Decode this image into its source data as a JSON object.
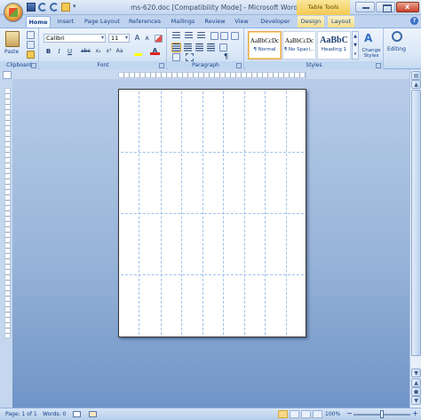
{
  "window": {
    "title": "ms-620.doc [Compatibility Mode] - Microsoft Word",
    "contextual_tab_group": "Table Tools"
  },
  "tabs": [
    {
      "label": "Home",
      "active": true
    },
    {
      "label": "Insert"
    },
    {
      "label": "Page Layout"
    },
    {
      "label": "References"
    },
    {
      "label": "Mailings"
    },
    {
      "label": "Review"
    },
    {
      "label": "View"
    },
    {
      "label": "Developer"
    },
    {
      "label": "Design",
      "contextual": true
    },
    {
      "label": "Layout",
      "contextual": true
    }
  ],
  "ribbon": {
    "clipboard": {
      "label": "Clipboard",
      "paste_label": "Paste"
    },
    "font": {
      "label": "Font",
      "font_name": "Calibri",
      "font_size": "11",
      "bold": "B",
      "italic": "I",
      "underline": "U",
      "strikethrough": "abc",
      "subscript": "x₂",
      "superscript": "x²",
      "change_case": "Aa",
      "grow_font": "A",
      "shrink_font": "A",
      "highlight_color": "#ffff00",
      "font_color": "#e02020",
      "font_color_glyph": "A"
    },
    "paragraph": {
      "label": "Paragraph",
      "show_marks": "¶"
    },
    "styles": {
      "label": "Styles",
      "items": [
        {
          "sample": "AaBbCcDc",
          "name": "¶ Normal",
          "selected": true
        },
        {
          "sample": "AaBbCcDc",
          "name": "¶ No Spaci..."
        },
        {
          "sample": "AaBbC",
          "name": "Heading 1"
        }
      ],
      "change_styles_label": "Change Styles",
      "change_styles_icon_glyph": "A"
    },
    "editing": {
      "label": "Editing"
    }
  },
  "status_bar": {
    "page": "Page: 1 of 1",
    "words": "Words: 0",
    "zoom": "100%",
    "zoom_minus": "−",
    "zoom_plus": "+"
  },
  "help_glyph": "?",
  "colors": {
    "ribbon_blue": "#15428b",
    "contextual_yellow": "#f2c852",
    "doc_bg": "#8eaad3"
  }
}
